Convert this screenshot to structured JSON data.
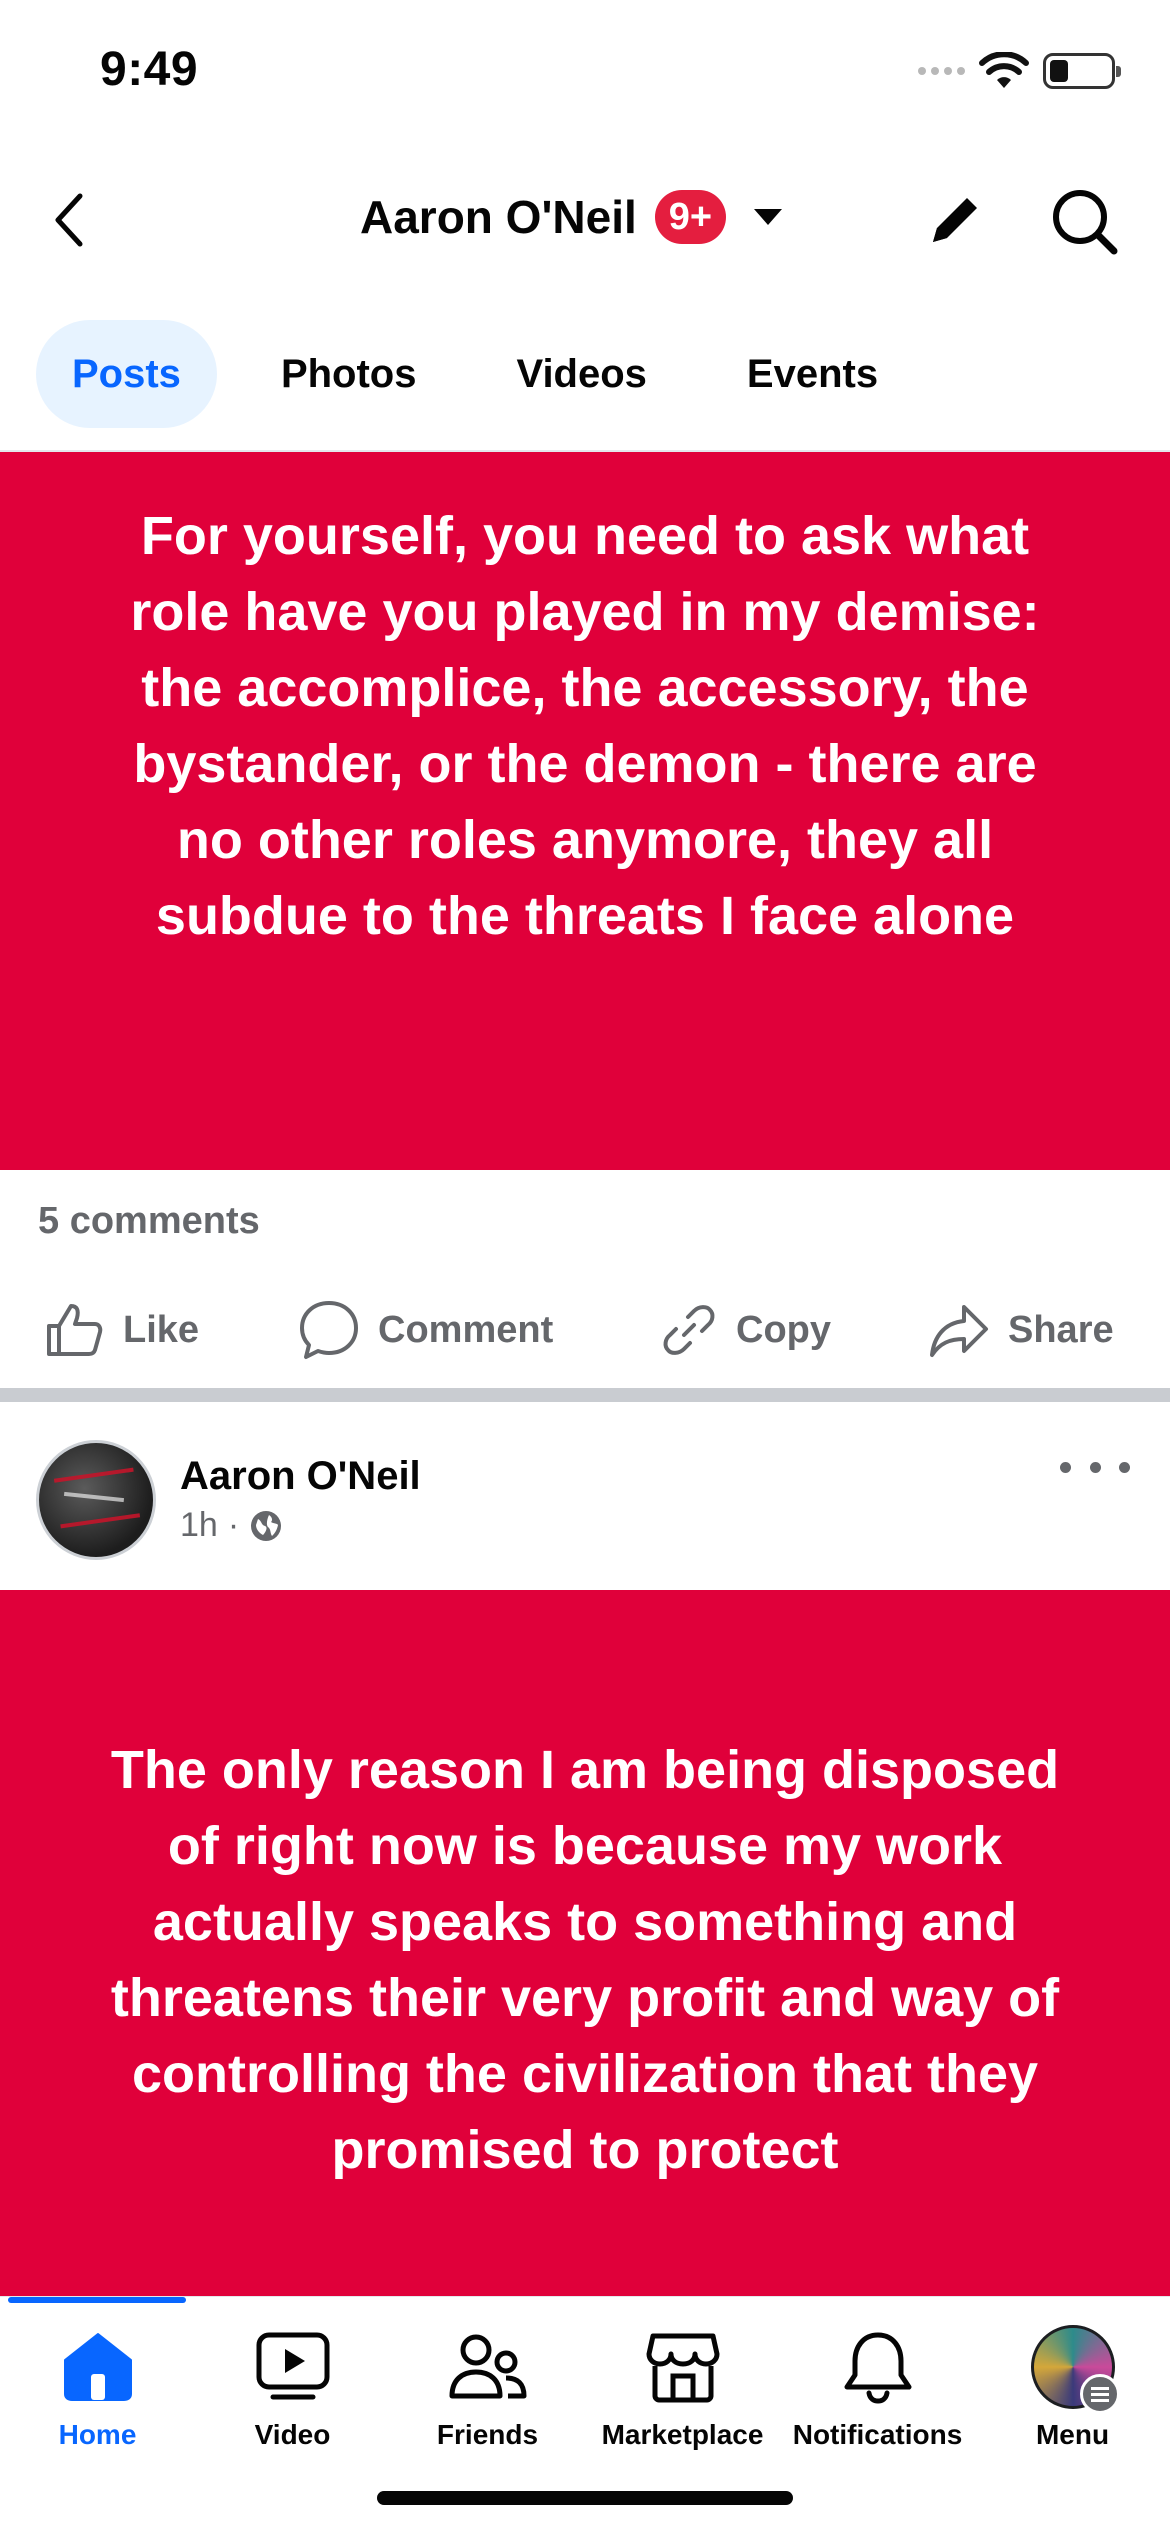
{
  "status_bar": {
    "time": "9:49"
  },
  "header": {
    "title": "Aaron O'Neil",
    "badge": "9+"
  },
  "tabs": [
    {
      "label": "Posts",
      "active": true
    },
    {
      "label": "Photos",
      "active": false
    },
    {
      "label": "Videos",
      "active": false
    },
    {
      "label": "Events",
      "active": false
    }
  ],
  "post1": {
    "text": "For yourself, you need to ask what role have you played in my demise: the accomplice, the accessory, the bystander, or the demon - there are no other roles anymore, they all subdue to the threats I face alone",
    "background_color": "#e0003a",
    "comments": "5 comments",
    "actions": {
      "like": "Like",
      "comment": "Comment",
      "copy": "Copy",
      "share": "Share"
    }
  },
  "post2": {
    "author": "Aaron O'Neil",
    "time": "1h",
    "audience_icon": "globe-icon",
    "text": "The only reason I am being disposed of right now is because my work actually speaks to something and threatens their very profit and way of controlling the civilization that they promised to protect",
    "background_color": "#e0003a"
  },
  "bottom_nav": {
    "items": [
      {
        "label": "Home",
        "icon": "home-icon",
        "active": true
      },
      {
        "label": "Video",
        "icon": "video-icon",
        "active": false
      },
      {
        "label": "Friends",
        "icon": "friends-icon",
        "active": false
      },
      {
        "label": "Marketplace",
        "icon": "marketplace-icon",
        "active": false
      },
      {
        "label": "Notifications",
        "icon": "bell-icon",
        "active": false
      },
      {
        "label": "Menu",
        "icon": "profile-menu-icon",
        "active": false
      }
    ]
  },
  "colors": {
    "accent": "#0866ff",
    "post_bg": "#e0003a",
    "badge": "#e41e3f",
    "muted": "#65676b"
  }
}
